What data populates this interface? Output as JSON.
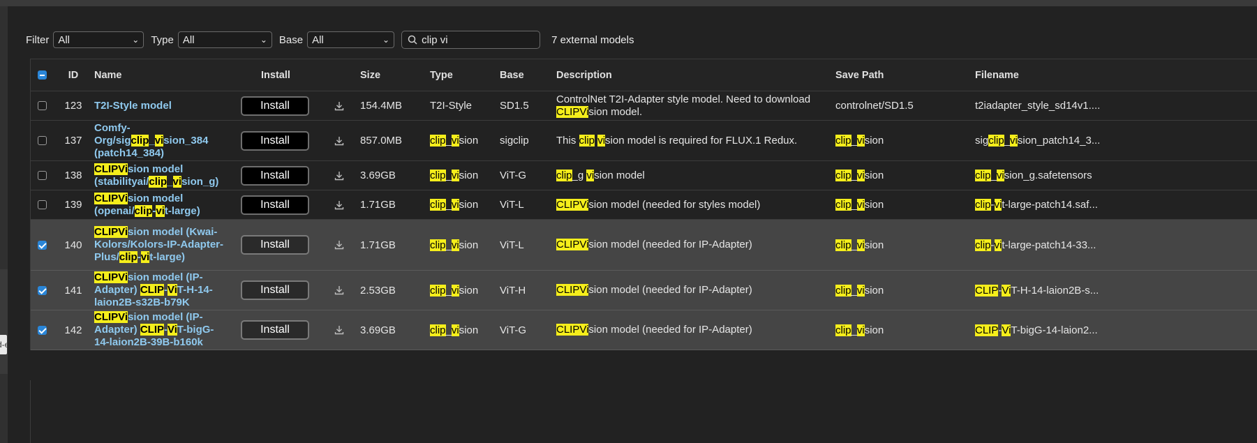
{
  "toolbar": {
    "filter_label": "Filter",
    "filter_value": "All",
    "type_label": "Type",
    "type_value": "All",
    "base_label": "Base",
    "base_value": "All",
    "search_value": "clip vi",
    "count_text": "7 external models"
  },
  "columns": {
    "id": "ID",
    "name": "Name",
    "install": "Install",
    "size": "Size",
    "type": "Type",
    "base": "Base",
    "description": "Description",
    "save_path": "Save Path",
    "filename": "Filename"
  },
  "install_label": "Install",
  "edge_tab_text": "d-e",
  "rows": [
    {
      "id": "123",
      "checked": false,
      "name": [
        [
          "T2I-Style model",
          false
        ]
      ],
      "size": "154.4MB",
      "type": [
        [
          "T2I-Style",
          false
        ]
      ],
      "base": "SD1.5",
      "desc": [
        [
          "ControlNet T2I-Adapter style model. Need to download ",
          false
        ],
        [
          "CLIPVi",
          true
        ],
        [
          "sion model.",
          false
        ]
      ],
      "path": [
        [
          "controlnet/SD1.5",
          false
        ]
      ],
      "file": [
        [
          "t2iadapter_style_sd14v1....",
          false
        ]
      ]
    },
    {
      "id": "137",
      "checked": false,
      "name": [
        [
          "Comfy-Org/sig",
          false
        ],
        [
          "clip",
          true
        ],
        [
          "_",
          false
        ],
        [
          "vi",
          true
        ],
        [
          "sion_384 (patch14_384)",
          false
        ]
      ],
      "size": "857.0MB",
      "type": [
        [
          "clip",
          true
        ],
        [
          "_",
          false
        ],
        [
          "vi",
          true
        ],
        [
          "sion",
          false
        ]
      ],
      "base": "sigclip",
      "desc": [
        [
          "This ",
          false
        ],
        [
          "clip",
          true
        ],
        [
          " ",
          false
        ],
        [
          "vi",
          true
        ],
        [
          "sion model is required for FLUX.1 Redux.",
          false
        ]
      ],
      "path": [
        [
          "clip",
          true
        ],
        [
          "_",
          false
        ],
        [
          "vi",
          true
        ],
        [
          "sion",
          false
        ]
      ],
      "file": [
        [
          "sig",
          false
        ],
        [
          "clip",
          true
        ],
        [
          "_",
          false
        ],
        [
          "vi",
          true
        ],
        [
          "sion_patch14_3...",
          false
        ]
      ]
    },
    {
      "id": "138",
      "checked": false,
      "name": [
        [
          "CLIPVi",
          true
        ],
        [
          "sion model (stabilityai/",
          false
        ],
        [
          "clip",
          true
        ],
        [
          "_",
          false
        ],
        [
          "vi",
          true
        ],
        [
          "sion_g)",
          false
        ]
      ],
      "size": "3.69GB",
      "type": [
        [
          "clip",
          true
        ],
        [
          "_",
          false
        ],
        [
          "vi",
          true
        ],
        [
          "sion",
          false
        ]
      ],
      "base": "ViT-G",
      "desc": [
        [
          "clip",
          true
        ],
        [
          "_g ",
          false
        ],
        [
          "vi",
          true
        ],
        [
          "sion model",
          false
        ]
      ],
      "path": [
        [
          "clip",
          true
        ],
        [
          "_",
          false
        ],
        [
          "vi",
          true
        ],
        [
          "sion",
          false
        ]
      ],
      "file": [
        [
          "clip",
          true
        ],
        [
          "_",
          false
        ],
        [
          "vi",
          true
        ],
        [
          "sion_g.safetensors",
          false
        ]
      ]
    },
    {
      "id": "139",
      "checked": false,
      "name": [
        [
          "CLIPVi",
          true
        ],
        [
          "sion model (openai/",
          false
        ],
        [
          "clip",
          true
        ],
        [
          "-",
          false
        ],
        [
          "vi",
          true
        ],
        [
          "t-large)",
          false
        ]
      ],
      "size": "1.71GB",
      "type": [
        [
          "clip",
          true
        ],
        [
          "_",
          false
        ],
        [
          "vi",
          true
        ],
        [
          "sion",
          false
        ]
      ],
      "base": "ViT-L",
      "desc": [
        [
          "CLIPVi",
          true
        ],
        [
          "sion model (needed for styles model)",
          false
        ]
      ],
      "path": [
        [
          "clip",
          true
        ],
        [
          "_",
          false
        ],
        [
          "vi",
          true
        ],
        [
          "sion",
          false
        ]
      ],
      "file": [
        [
          "clip",
          true
        ],
        [
          "-",
          false
        ],
        [
          "vi",
          true
        ],
        [
          "t-large-patch14.saf...",
          false
        ]
      ]
    },
    {
      "id": "140",
      "checked": true,
      "name": [
        [
          "CLIPVi",
          true
        ],
        [
          "sion model (Kwai-Kolors/Kolors-IP-Adapter-Plus/",
          false
        ],
        [
          "clip",
          true
        ],
        [
          "-",
          false
        ],
        [
          "vi",
          true
        ],
        [
          "t-large)",
          false
        ]
      ],
      "size": "1.71GB",
      "type": [
        [
          "clip",
          true
        ],
        [
          "_",
          false
        ],
        [
          "vi",
          true
        ],
        [
          "sion",
          false
        ]
      ],
      "base": "ViT-L",
      "desc": [
        [
          "CLIPVi",
          true
        ],
        [
          "sion model (needed for IP-Adapter)",
          false
        ]
      ],
      "path": [
        [
          "clip",
          true
        ],
        [
          "_",
          false
        ],
        [
          "vi",
          true
        ],
        [
          "sion",
          false
        ]
      ],
      "file": [
        [
          "clip",
          true
        ],
        [
          "-",
          false
        ],
        [
          "vi",
          true
        ],
        [
          "t-large-patch14-33...",
          false
        ]
      ]
    },
    {
      "id": "141",
      "checked": true,
      "name": [
        [
          "CLIPVi",
          true
        ],
        [
          "sion model (IP-Adapter) ",
          false
        ],
        [
          "CLIP",
          true
        ],
        [
          "-",
          false
        ],
        [
          "Vi",
          true
        ],
        [
          "T-H-14-laion2B-s32B-b79K",
          false
        ]
      ],
      "size": "2.53GB",
      "type": [
        [
          "clip",
          true
        ],
        [
          "_",
          false
        ],
        [
          "vi",
          true
        ],
        [
          "sion",
          false
        ]
      ],
      "base": "ViT-H",
      "desc": [
        [
          "CLIPVi",
          true
        ],
        [
          "sion model (needed for IP-Adapter)",
          false
        ]
      ],
      "path": [
        [
          "clip",
          true
        ],
        [
          "_",
          false
        ],
        [
          "vi",
          true
        ],
        [
          "sion",
          false
        ]
      ],
      "file": [
        [
          "CLIP",
          true
        ],
        [
          "-",
          false
        ],
        [
          "Vi",
          true
        ],
        [
          "T-H-14-laion2B-s...",
          false
        ]
      ]
    },
    {
      "id": "142",
      "checked": true,
      "name": [
        [
          "CLIPVi",
          true
        ],
        [
          "sion model (IP-Adapter) ",
          false
        ],
        [
          "CLIP",
          true
        ],
        [
          "-",
          false
        ],
        [
          "Vi",
          true
        ],
        [
          "T-bigG-14-laion2B-39B-b160k",
          false
        ]
      ],
      "size": "3.69GB",
      "type": [
        [
          "clip",
          true
        ],
        [
          "_",
          false
        ],
        [
          "vi",
          true
        ],
        [
          "sion",
          false
        ]
      ],
      "base": "ViT-G",
      "desc": [
        [
          "CLIPVi",
          true
        ],
        [
          "sion model (needed for IP-Adapter)",
          false
        ]
      ],
      "path": [
        [
          "clip",
          true
        ],
        [
          "_",
          false
        ],
        [
          "vi",
          true
        ],
        [
          "sion",
          false
        ]
      ],
      "file": [
        [
          "CLIP",
          true
        ],
        [
          "-",
          false
        ],
        [
          "Vi",
          true
        ],
        [
          "T-bigG-14-laion2...",
          false
        ]
      ]
    }
  ],
  "colors": {
    "highlight": "#f5ee1b",
    "name_link": "#8fc9ee",
    "checkbox_on": "#2a86d8",
    "selected_row": "#454545"
  }
}
